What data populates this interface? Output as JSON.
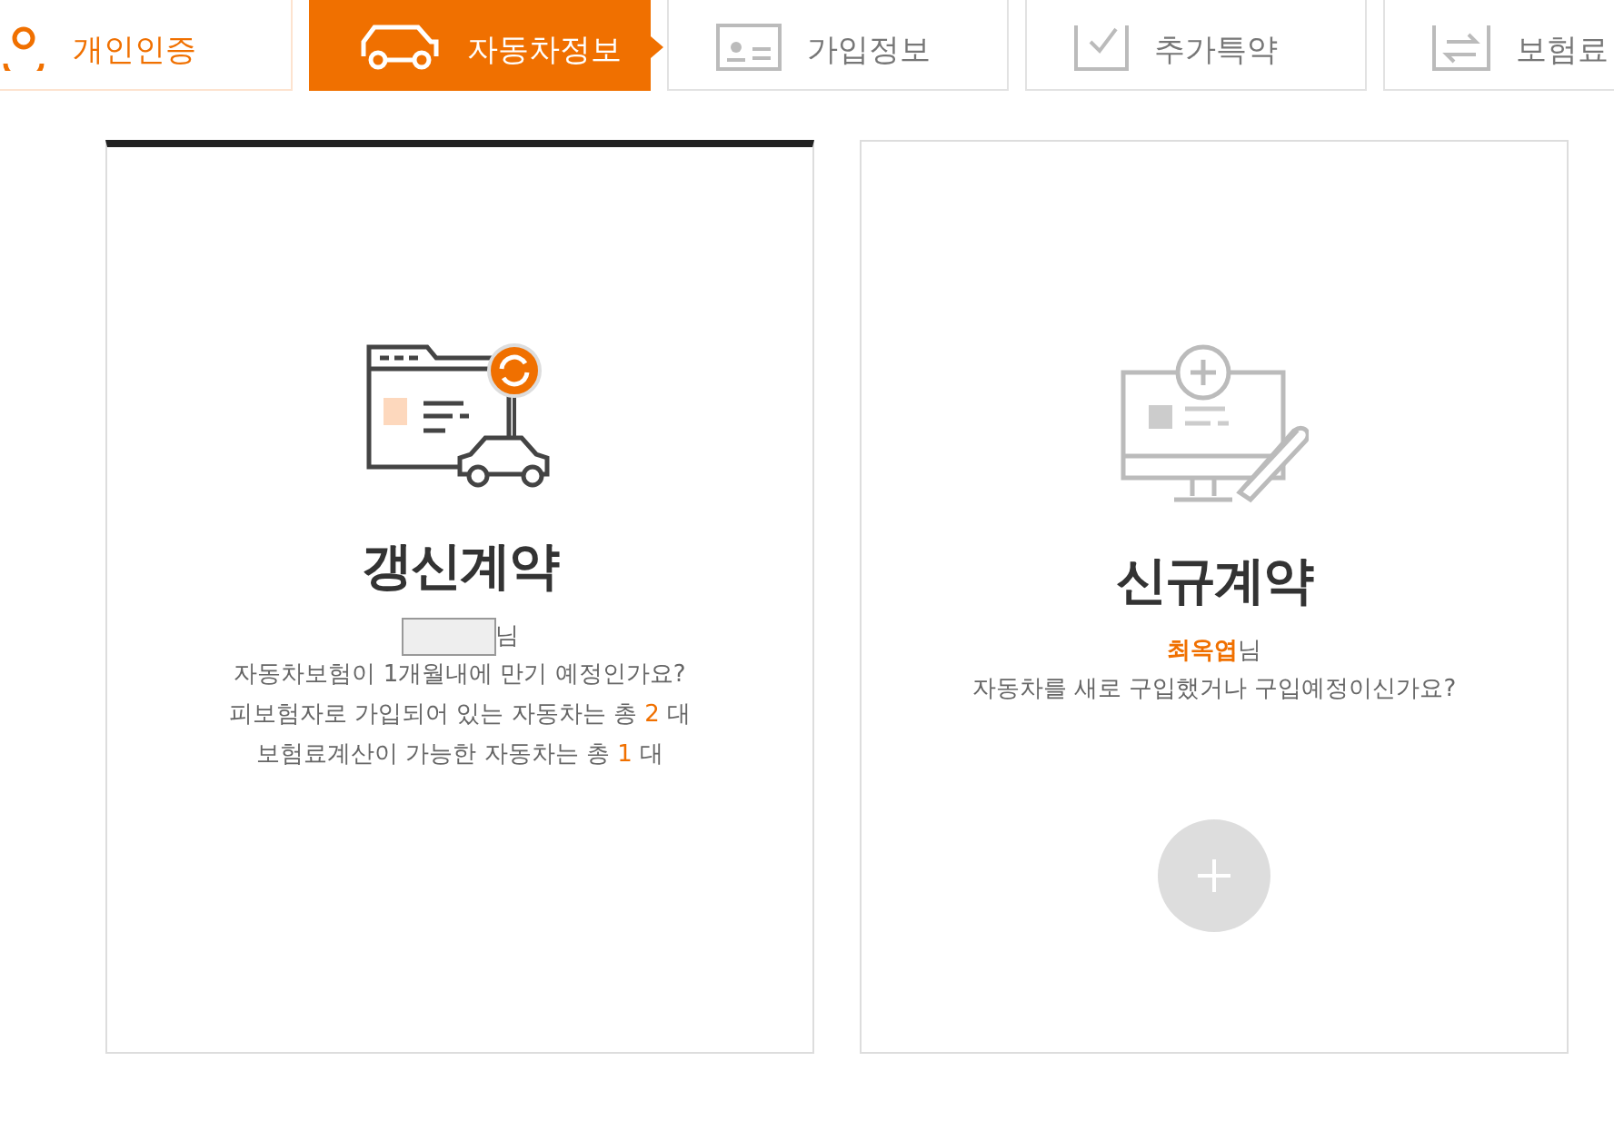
{
  "steps": [
    {
      "label": "개인인증",
      "selected": false,
      "done": true
    },
    {
      "label": "자동차정보",
      "selected": true,
      "done": false
    },
    {
      "label": "가입정보",
      "selected": false,
      "done": false
    },
    {
      "label": "추가특약",
      "selected": false,
      "done": false
    },
    {
      "label": "보험료",
      "selected": false,
      "done": false
    }
  ],
  "options": [
    {
      "kind": "renewal",
      "title": "갱신계약",
      "selected": true,
      "name": {
        "masked": true,
        "suffix": "님"
      },
      "lines": [
        {
          "text": "자동차보험이 1개월내에 만기 예정인가요?"
        },
        {
          "text": "피보험자로 가입되어 있는 자동차는 총",
          "count": "2",
          "unit": "대"
        },
        {
          "text": "보험료계산이 가능한 자동차는 총",
          "count": "1",
          "unit": "대"
        }
      ]
    },
    {
      "kind": "new",
      "title": "신규계약",
      "selected": false,
      "name": {
        "masked": false,
        "value": "최옥엽",
        "suffix": "님"
      },
      "lines": [
        {
          "text": "자동차를 새로 구입했거나 구입예정이신가요?"
        }
      ]
    }
  ]
}
